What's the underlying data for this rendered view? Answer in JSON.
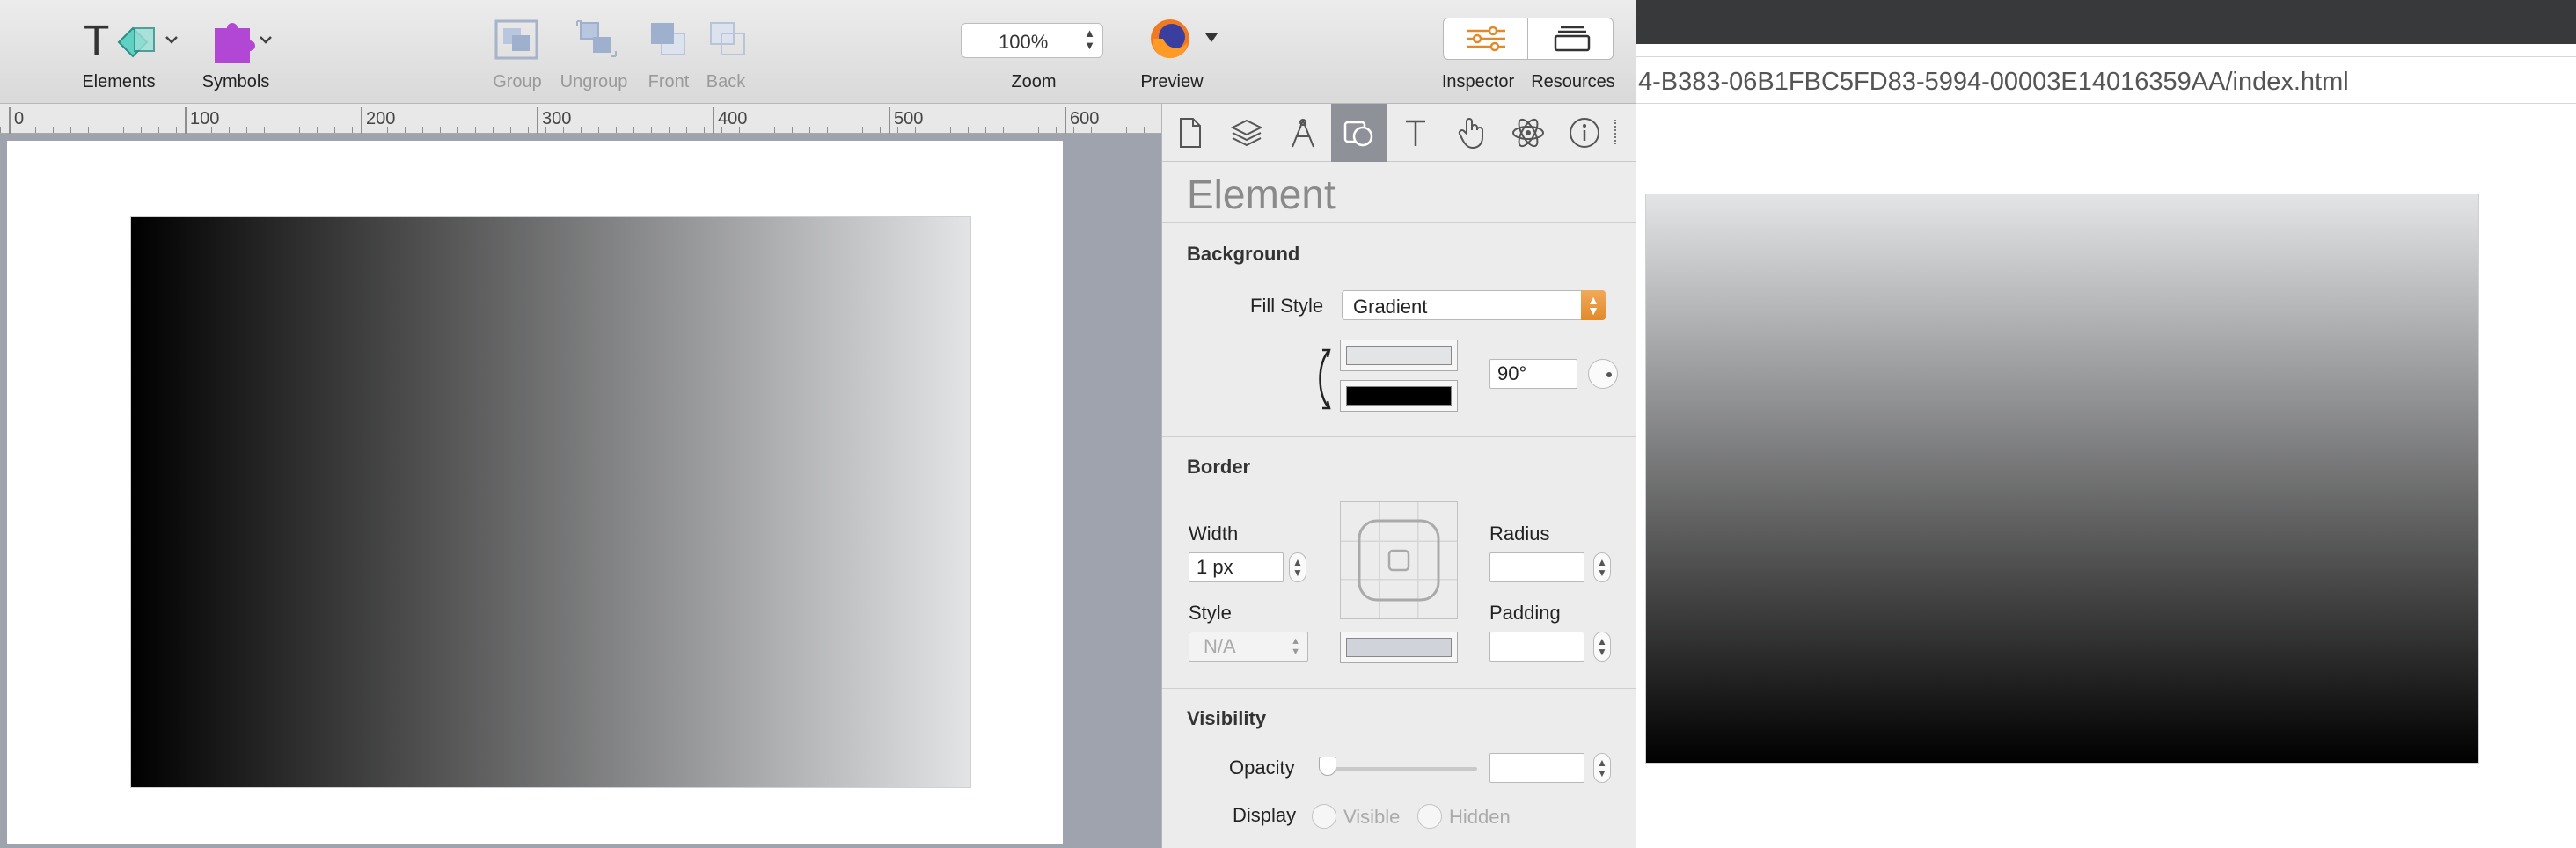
{
  "toolbar": {
    "elements_label": "Elements",
    "symbols_label": "Symbols",
    "group_label": "Group",
    "ungroup_label": "Ungroup",
    "front_label": "Front",
    "back_label": "Back",
    "zoom_value": "100%",
    "zoom_label": "Zoom",
    "preview_label": "Preview",
    "inspector_label": "Inspector",
    "resources_label": "Resources"
  },
  "ruler": {
    "ticks": [
      "0",
      "100",
      "200",
      "300",
      "400",
      "500",
      "600"
    ]
  },
  "canvas": {
    "element_gradient": {
      "direction": "left-to-right",
      "start_color": "#000000",
      "end_color": "#e3e4e6"
    }
  },
  "inspector": {
    "tabs": [
      "document-icon",
      "layers-icon",
      "metrics-icon",
      "style-icon",
      "text-icon",
      "actions-icon",
      "atom-icon",
      "info-icon"
    ],
    "active_tab": "style-icon",
    "title": "Element",
    "background": {
      "section_title": "Background",
      "fill_style_label": "Fill Style",
      "fill_style_value": "Gradient",
      "angle": "90°",
      "top_swatch_color": "#e3e4e6",
      "bottom_swatch_color": "#000000"
    },
    "border": {
      "section_title": "Border",
      "width_label": "Width",
      "width_value": "1 px",
      "style_label": "Style",
      "style_value": "N/A",
      "radius_label": "Radius",
      "padding_label": "Padding",
      "color_swatch": "#d0d3da"
    },
    "visibility": {
      "section_title": "Visibility",
      "opacity_label": "Opacity",
      "display_label": "Display",
      "visible_label": "Visible",
      "hidden_label": "Hidden"
    }
  },
  "browser": {
    "url_text": "4-B383-06B1FBC5FD83-5994-00003E14016359AA/index.html",
    "preview_gradient": {
      "direction": "top-to-bottom",
      "start_color": "#e3e4e6",
      "end_color": "#000000"
    }
  },
  "colors": {
    "accent": "#e28a2b",
    "active_tab": "#8f9198"
  }
}
